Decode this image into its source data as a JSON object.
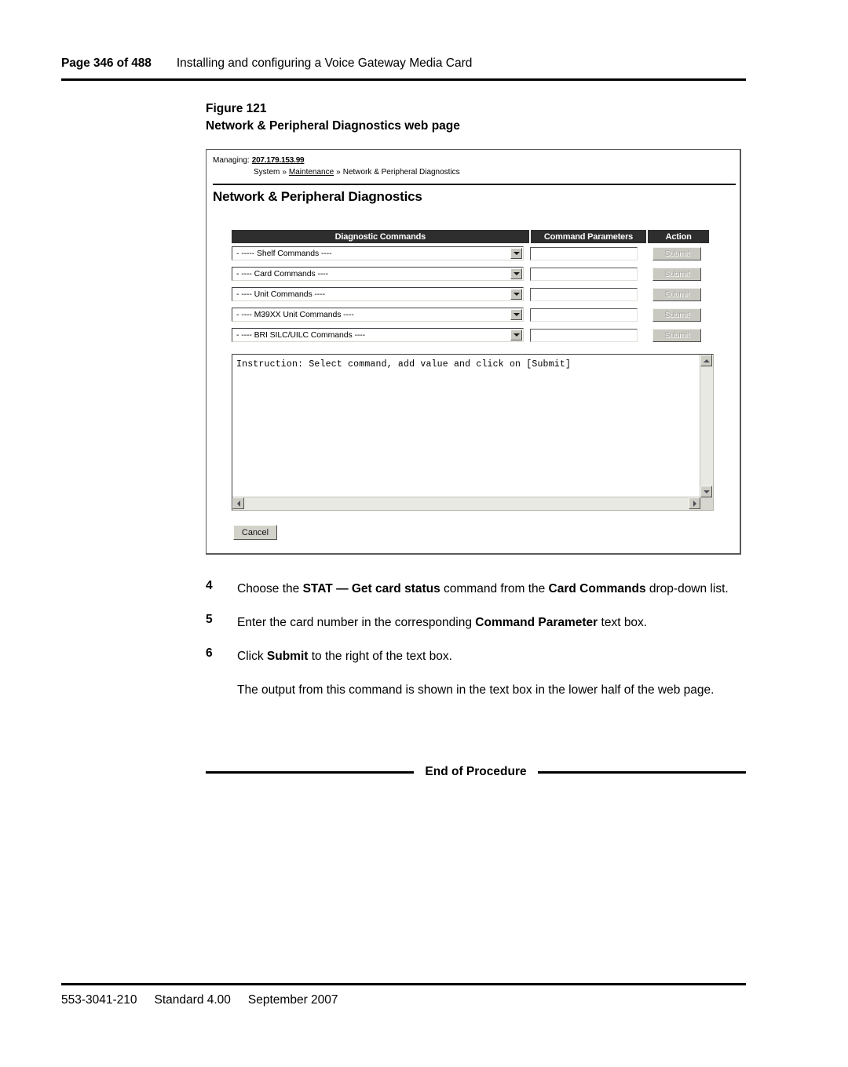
{
  "header": {
    "page_number": "Page 346 of 488",
    "title": "Installing and configuring a Voice Gateway Media Card"
  },
  "figure": {
    "number": "Figure 121",
    "caption": "Network & Peripheral Diagnostics web page",
    "webpage": {
      "managing_label": "Managing:",
      "managing_ip": "207.179.153.99",
      "breadcrumb": {
        "item1": "System",
        "sep1": "»",
        "item2": "Maintenance",
        "sep2": "»",
        "item3": "Network & Peripheral Diagnostics"
      },
      "page_heading": "Network & Peripheral Diagnostics",
      "table": {
        "headers": {
          "commands": "Diagnostic Commands",
          "parameters": "Command Parameters",
          "action": "Action"
        },
        "rows": [
          {
            "select_value": "- ----- Shelf Commands ----",
            "param_value": "",
            "action_label": "Submit"
          },
          {
            "select_value": "- ---- Card Commands ----",
            "param_value": "",
            "action_label": "Submit"
          },
          {
            "select_value": "- ---- Unit Commands ----",
            "param_value": "",
            "action_label": "Submit"
          },
          {
            "select_value": "- ---- M39XX Unit Commands ----",
            "param_value": "",
            "action_label": "Submit"
          },
          {
            "select_value": "- ---- BRI SILC/UILC Commands ----",
            "param_value": "",
            "action_label": "Submit"
          }
        ]
      },
      "output_text": "Instruction: Select command, add value and click on [Submit]",
      "cancel_label": "Cancel"
    }
  },
  "steps": [
    {
      "number": "4",
      "parts": [
        {
          "text": "Choose the ",
          "bold": false
        },
        {
          "text": "STAT — Get card status",
          "bold": true
        },
        {
          "text": " command from the ",
          "bold": false
        },
        {
          "text": "Card Commands",
          "bold": true
        },
        {
          "text": " drop-down list.",
          "bold": false
        }
      ]
    },
    {
      "number": "5",
      "parts": [
        {
          "text": "Enter the card number in the corresponding ",
          "bold": false
        },
        {
          "text": "Command Parameter",
          "bold": true
        },
        {
          "text": " text box.",
          "bold": false
        }
      ]
    },
    {
      "number": "6",
      "parts": [
        {
          "text": "Click ",
          "bold": false
        },
        {
          "text": "Submit",
          "bold": true
        },
        {
          "text": " to the right of the text box.",
          "bold": false
        }
      ]
    }
  ],
  "note": "The output from this command is shown in the text box in the lower half of the web page.",
  "end_of_procedure": "End of Procedure",
  "footer": {
    "doc_number": "553-3041-210",
    "standard": "Standard 4.00",
    "date": "September 2007"
  },
  "colors": {
    "table_header_bg": "#2e2e2e",
    "page_bg": "#ffffff",
    "rule": "#000000",
    "button_face": "#c9c9c1"
  }
}
